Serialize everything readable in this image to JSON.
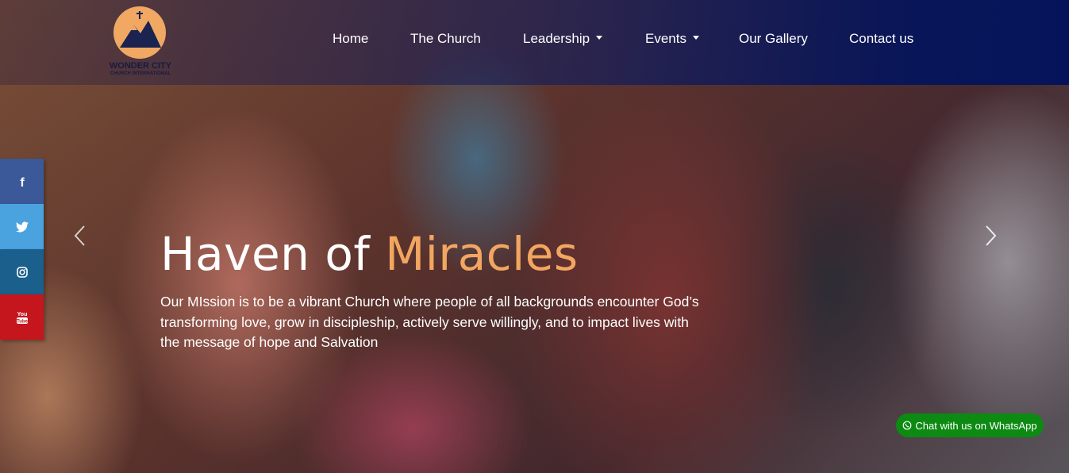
{
  "brand": {
    "name": "WONDER CITY",
    "subtitle": "CHURCH INTERNATIONAL",
    "logo_color": "#f0a862"
  },
  "nav": {
    "items": [
      {
        "label": "Home",
        "has_dropdown": false
      },
      {
        "label": "The Church",
        "has_dropdown": false
      },
      {
        "label": "Leadership",
        "has_dropdown": true
      },
      {
        "label": "Events",
        "has_dropdown": true
      },
      {
        "label": "Our Gallery",
        "has_dropdown": false
      },
      {
        "label": "Contact us",
        "has_dropdown": false
      }
    ]
  },
  "social": [
    {
      "name": "facebook",
      "icon": "facebook-icon",
      "color": "#3b5998"
    },
    {
      "name": "twitter",
      "icon": "twitter-icon",
      "color": "#4aa3df"
    },
    {
      "name": "instagram",
      "icon": "instagram-icon",
      "color": "#1b5f8c"
    },
    {
      "name": "youtube",
      "icon": "youtube-icon",
      "color": "#c4161c"
    }
  ],
  "hero": {
    "headline_part1": "Haven of ",
    "headline_part2": "Miracles",
    "accent_color": "#f3a660",
    "mission": "Our MIssion is to be a vibrant Church where people of all backgrounds encounter God’s transforming love, grow in discipleship, actively serve willingly, and to impact lives with the message of hope and Salvation"
  },
  "whatsapp": {
    "label": "Chat with us on WhatsApp",
    "color": "#0c8a12"
  }
}
